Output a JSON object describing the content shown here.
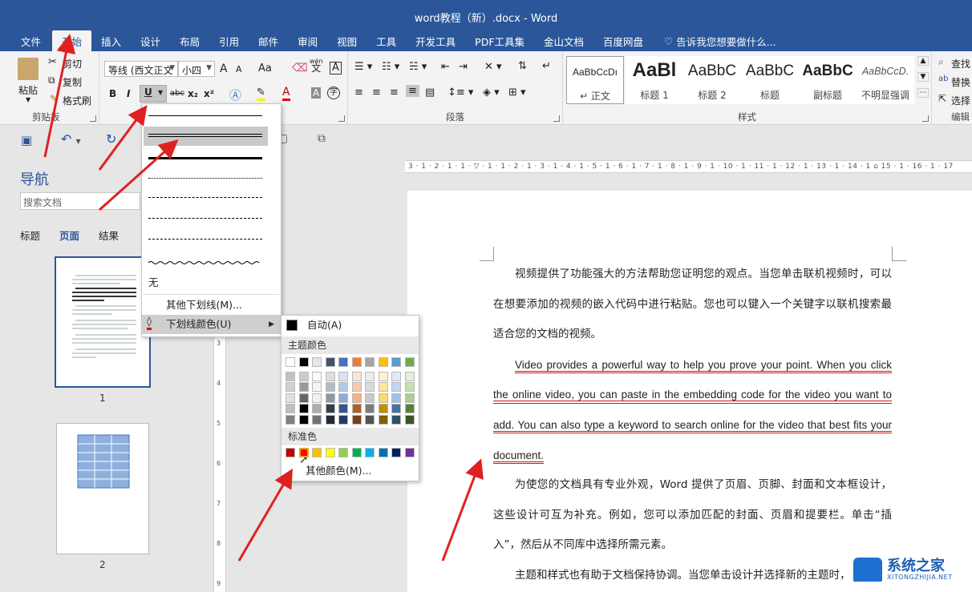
{
  "window": {
    "title": "word教程（新）.docx - Word"
  },
  "tabs": [
    "文件",
    "开始",
    "插入",
    "设计",
    "布局",
    "引用",
    "邮件",
    "审阅",
    "视图",
    "工具",
    "开发工具",
    "PDF工具集",
    "金山文档",
    "百度网盘"
  ],
  "active_tab": "开始",
  "tell_me": "告诉我您想要做什么...",
  "clipboard": {
    "paste": "粘贴",
    "cut": "剪切",
    "copy": "复制",
    "format_painter": "格式刷",
    "label": "剪贴板"
  },
  "font": {
    "name": "等线 (西文正文",
    "size": "小四",
    "bold": "B",
    "italic": "I",
    "underline": "U",
    "strike": "abc",
    "sub": "x₂",
    "sup": "x²",
    "grow": "A",
    "shrink": "A",
    "case": "Aa",
    "phonetic": "wén",
    "phonetic_base": "文",
    "border": "A",
    "shade": "A",
    "color": "A",
    "enclose": "字"
  },
  "paragraph": {
    "label": "段落"
  },
  "styles": {
    "label": "样式",
    "items": [
      {
        "preview": "AaBbCcDı",
        "name": "↵ 正文"
      },
      {
        "preview": "AaBl",
        "name": "标题 1"
      },
      {
        "preview": "AaBbC",
        "name": "标题 2"
      },
      {
        "preview": "AaBbC",
        "name": "标题"
      },
      {
        "preview": "AaBbC",
        "name": "副标题"
      },
      {
        "preview": "AaBbCcD.",
        "name": "不明显强调"
      }
    ]
  },
  "editing": {
    "find": "查找",
    "replace": "替换",
    "select": "选择",
    "label": "编辑"
  },
  "nav": {
    "title": "导航",
    "search_placeholder": "搜索文档",
    "tabs": [
      "标题",
      "页面",
      "结果"
    ],
    "active_tab": "页面",
    "pages": [
      "1",
      "2"
    ]
  },
  "underline_menu": {
    "none": "无",
    "more": "其他下划线(M)...",
    "color": "下划线颜色(U)"
  },
  "color_menu": {
    "auto": "自动(A)",
    "theme_label": "主题颜色",
    "standard_label": "标准色",
    "more": "其他颜色(M)...",
    "theme_top": [
      "#ffffff",
      "#000000",
      "#e7e6e6",
      "#44546a",
      "#4472c4",
      "#ed7d31",
      "#a5a5a5",
      "#ffc000",
      "#5b9bd5",
      "#70ad47"
    ],
    "standard": [
      "#c00000",
      "#ff0000",
      "#ffc000",
      "#ffff00",
      "#92d050",
      "#00b050",
      "#00b0f0",
      "#0070c0",
      "#002060",
      "#7030a0"
    ]
  },
  "ruler": "3 · 1 · 2 · 1 · 1 · ▽ · 1 · 1 · 2 · 1 · 3 · 1 · 4 · 1 · 5 · 1 · 6 · 1 · 7 · 1 · 8 · 1 · 9 · 1 · 10 · 1 · 11 · 1 · 12 · 1 · 13 · 1 · 14 · 1 ⌂ 15 · 1 · 16 · 1 · 17",
  "document": {
    "p1": "视频提供了功能强大的方法帮助您证明您的观点。当您单击联机视频时，可以在想要添加的视频的嵌入代码中进行粘贴。您也可以键入一个关键字以联机搜索最适合您的文档的视频。",
    "p2": "Video provides a powerful way to help you prove your point. When you click the online video, you can paste in the embedding code for the video you want to add. You can also type a keyword to search online for the video that best fits your document.",
    "p3": "为使您的文档具有专业外观，Word 提供了页眉、页脚、封面和文本框设计，这些设计可互为补充。例如，您可以添加匹配的封面、页眉和提要栏。单击“插入”，然后从不同库中选择所需元素。",
    "p4": "主题和样式也有助于文档保持协调。当您单击设计并选择新的主题时，"
  },
  "watermark": {
    "name": "系统之家",
    "url": "XITONGZHIJIA.NET"
  }
}
